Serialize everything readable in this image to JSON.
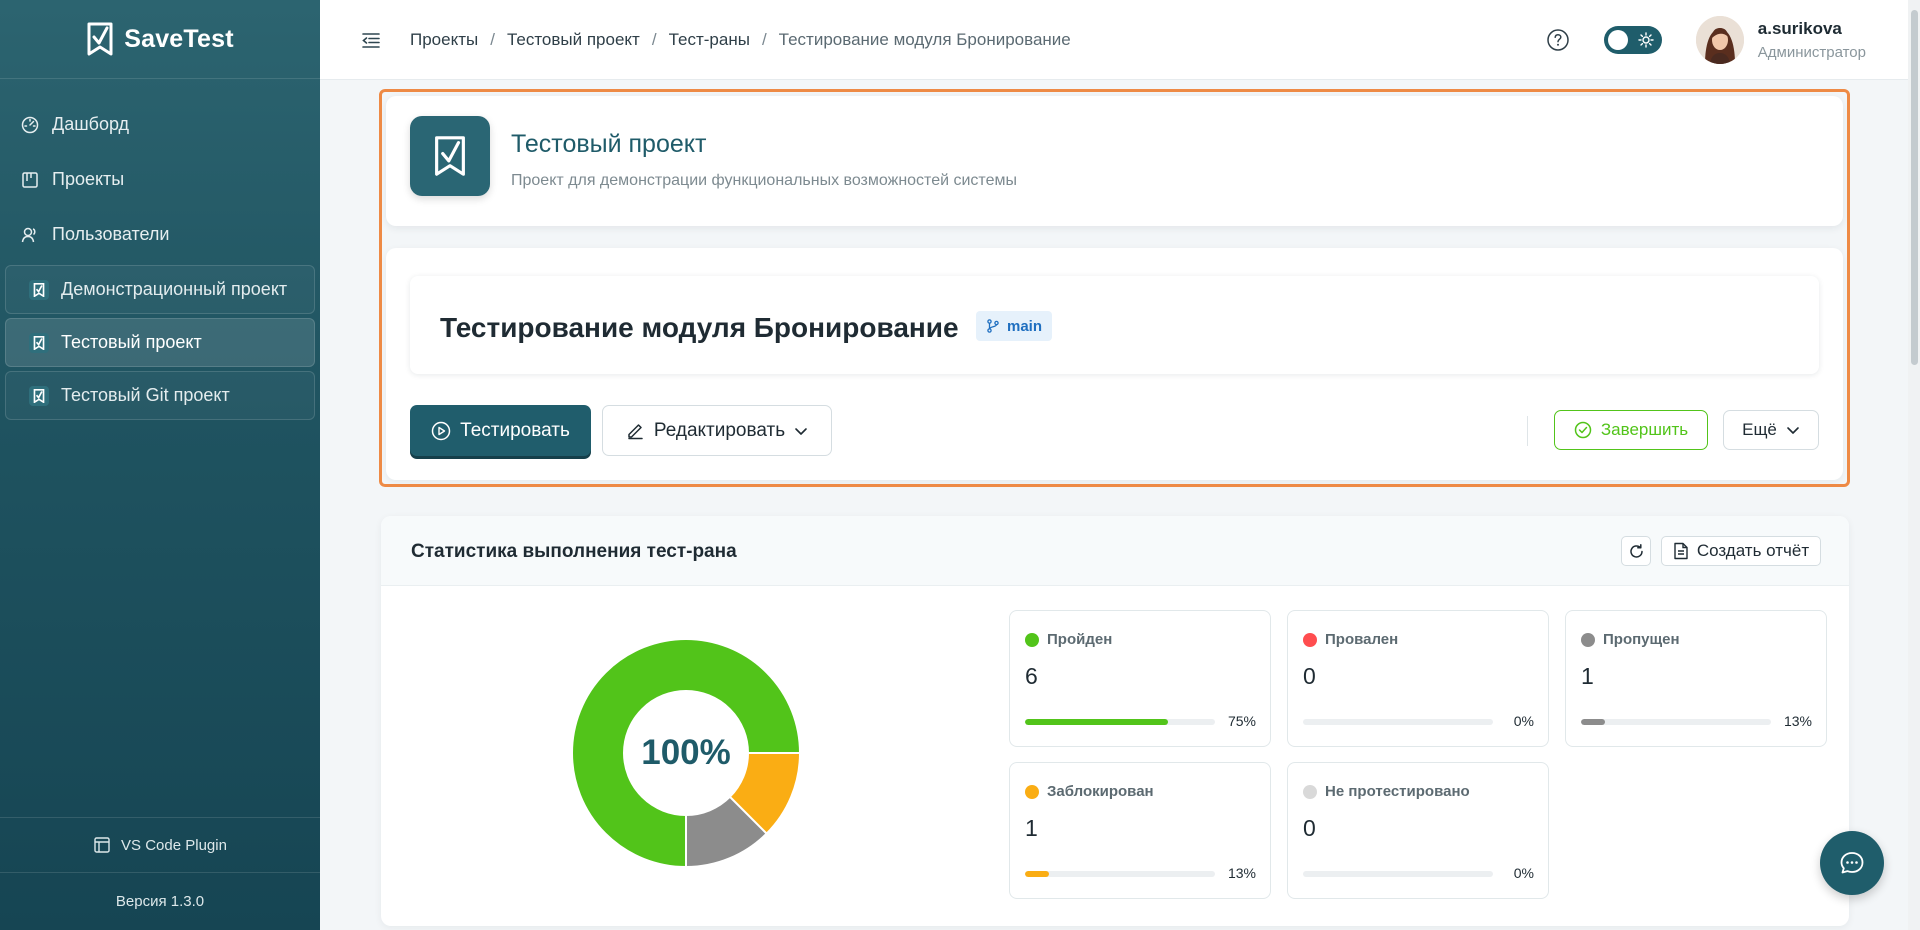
{
  "app": {
    "name": "SaveTest",
    "version": "Версия 1.3.0",
    "plugin_label": "VS Code Plugin"
  },
  "sidebar": {
    "nav": [
      {
        "label": "Дашборд",
        "icon": "dashboard-icon"
      },
      {
        "label": "Проекты",
        "icon": "projects-icon"
      },
      {
        "label": "Пользователи",
        "icon": "users-icon"
      }
    ],
    "projects": [
      {
        "label": "Демонстрационный проект",
        "active": false
      },
      {
        "label": "Тестовый проект",
        "active": true
      },
      {
        "label": "Тестовый Git проект",
        "active": false
      }
    ]
  },
  "header": {
    "breadcrumbs": [
      "Проекты",
      "Тестовый проект",
      "Тест-раны",
      "Тестирование модуля Бронирование"
    ],
    "user": {
      "name": "a.surikova",
      "role": "Администратор"
    }
  },
  "project": {
    "title": "Тестовый проект",
    "description": "Проект для демонстрации функциональных возможностей системы"
  },
  "run": {
    "title": "Тестирование модуля Бронирование",
    "branch": "main",
    "buttons": {
      "test": "Тестировать",
      "edit": "Редактировать",
      "finish": "Завершить",
      "more": "Ещё"
    }
  },
  "stats": {
    "title": "Статистика выполнения тест-рана",
    "report_button": "Создать отчёт",
    "center_label": "100%",
    "items": [
      {
        "label": "Пройден",
        "value": "6",
        "percent": "75%",
        "fraction": 0.75,
        "color": "#52c41a"
      },
      {
        "label": "Провален",
        "value": "0",
        "percent": "0%",
        "fraction": 0,
        "color": "#ff4d4f"
      },
      {
        "label": "Пропущен",
        "value": "1",
        "percent": "13%",
        "fraction": 0.125,
        "color": "#8c8c8c"
      },
      {
        "label": "Заблокирован",
        "value": "1",
        "percent": "13%",
        "fraction": 0.125,
        "color": "#faad14"
      },
      {
        "label": "Не протестировано",
        "value": "0",
        "percent": "0%",
        "fraction": 0,
        "color": "#d9d9d9"
      }
    ]
  },
  "colors": {
    "primary": "#205d6c",
    "accent_orange": "#ee8a45",
    "success": "#52c41a"
  }
}
